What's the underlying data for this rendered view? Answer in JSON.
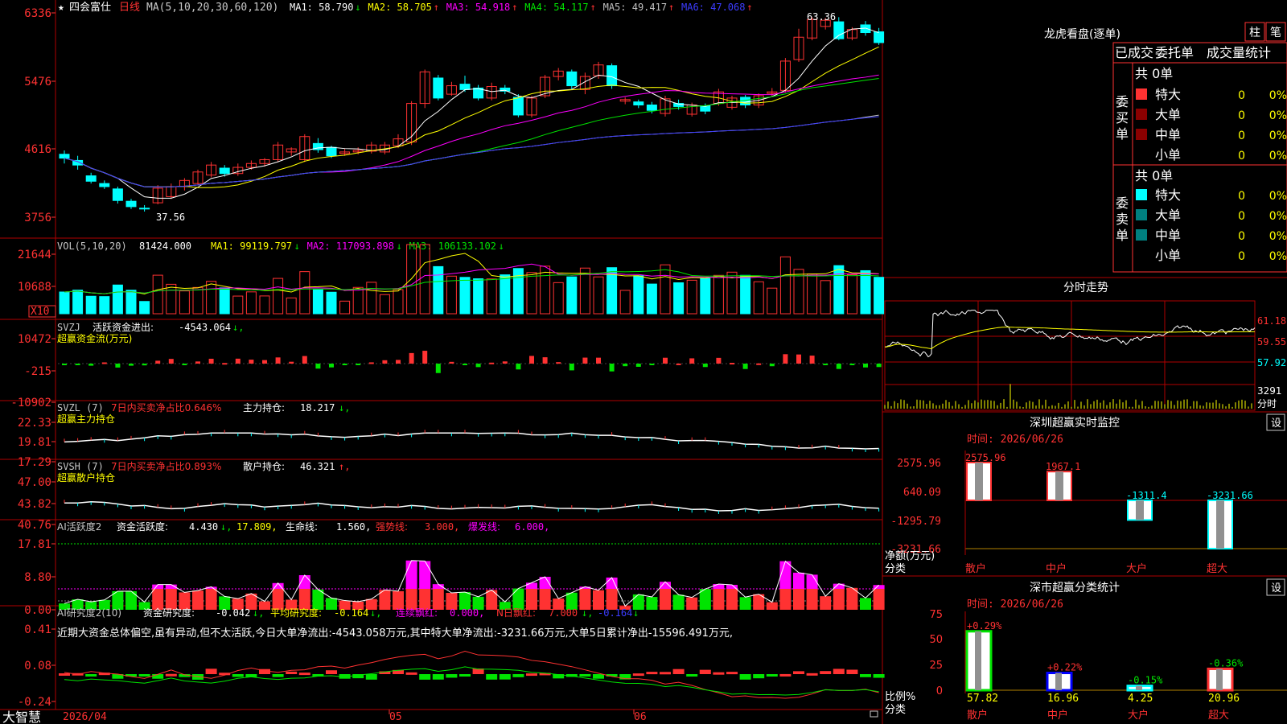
{
  "colors": {
    "red": "#ff3232",
    "cyan": "#00ffff",
    "white": "#ffffff",
    "yellow": "#ffff00",
    "magenta": "#ff00ff",
    "green": "#00e400",
    "blue": "#0000ff",
    "gray": "#c0c0c0",
    "grid": "#b00000"
  },
  "main": {
    "star": "★",
    "stock_name": "四会富仕",
    "period": "日线",
    "ma_label": "MA(5,10,20,30,60,120)",
    "ma_items": [
      {
        "name": "MA1:",
        "value": "58.790",
        "arrow": "↓",
        "color": "#ffffff"
      },
      {
        "name": "MA2:",
        "value": "58.705",
        "arrow": "↑",
        "color": "#ffff00"
      },
      {
        "name": "MA3:",
        "value": "54.918",
        "arrow": "↑",
        "color": "#ff00ff"
      },
      {
        "name": "MA4:",
        "value": "54.117",
        "arrow": "↑",
        "color": "#00e400"
      },
      {
        "name": "MA5:",
        "value": "49.417",
        "arrow": "↑",
        "color": "#c0c0c0"
      },
      {
        "name": "MA6:",
        "value": "47.068",
        "arrow": "↑",
        "color": "#3c3cff"
      }
    ],
    "y_ticks": [
      "6336",
      "5476",
      "4616",
      "3756"
    ],
    "high_label": "63.36",
    "low_label": "37.56"
  },
  "vol": {
    "label": "VOL(5,10,20)",
    "value": "81424.000",
    "items": [
      {
        "name": "MA1:",
        "value": "99119.797",
        "arrow": "↓",
        "color": "#ffff00"
      },
      {
        "name": "MA2:",
        "value": "117093.898",
        "arrow": "↓",
        "color": "#ff00ff"
      },
      {
        "name": "MA3:",
        "value": "106133.102",
        "arrow": "↓",
        "color": "#00e400"
      }
    ],
    "y_ticks": [
      "21644",
      "10688"
    ],
    "unit": "X10"
  },
  "svzj": {
    "label": "SVZJ",
    "title": "活跃资金进出:",
    "value": "-4543.064",
    "arrow": "↓,",
    "subtitle": "超赢资金流(万元)",
    "y_ticks": [
      "10472",
      "-215",
      "-10902"
    ]
  },
  "svzl": {
    "label": "SVZL (7)",
    "text1": "7日内买卖净占比0.646%",
    "text2": "主力持仓:",
    "value": "18.217",
    "arrow": "↓,",
    "subtitle": "超赢主力持仓",
    "y_ticks": [
      "22.33",
      "19.81",
      "17.29"
    ]
  },
  "svsh": {
    "label": "SVSH (7)",
    "text1": "7日内买卖净占比0.893%",
    "text2": "散户持仓:",
    "value": "46.321",
    "arrow": "↑,",
    "subtitle": "超赢散户持仓",
    "y_ticks": [
      "47.00",
      "43.82",
      "40.76"
    ]
  },
  "ai1": {
    "label": "AI活跃度2",
    "t1": "资金活跃度:",
    "v1": "4.430",
    "a1": "↓,",
    "v2": "17.809,",
    "t3": "生命线:",
    "v3": "1.560,",
    "t4": "强势线:",
    "v4": "3.000,",
    "t5": "爆发线:",
    "v5": "6.000,",
    "y_ticks": [
      "17.81",
      "8.80",
      "0.00"
    ]
  },
  "ai2": {
    "label": "AI研究度2(10)",
    "t1": "资金研究度:",
    "v1": "-0.042",
    "a1": "↓,",
    "t2": "平均研究度:",
    "v2": "-0.164",
    "a2": "↓,",
    "t3": "连续飘红:",
    "v3": "0.000,",
    "t4": "N日飘红:",
    "v4": "7.000",
    "a4": "↓,",
    "v5": "-0.164",
    "a5": "↓",
    "comment": "近期大资金总体偏空,虽有异动,但不太活跃,今日大单净流出:-4543.058万元,其中特大单净流出:-3231.66万元,大单5日累计净出-15596.491万元,",
    "y_ticks": [
      "0.41",
      "0.08",
      "-0.24"
    ]
  },
  "footer": {
    "brand": "大智慧",
    "date": "2026/04",
    "m1": "05",
    "m2": "06"
  },
  "right": {
    "title": "龙虎看盘(逐单)",
    "btn1": "柱",
    "btn2": "笔",
    "tabs": [
      "已成交",
      "委托单",
      "成交量统计"
    ],
    "buy_label": "委买单",
    "sell_label": "委卖单",
    "buy_total": "共 0单",
    "sell_total": "共 0单",
    "rows": [
      {
        "name": "特大",
        "count": "0",
        "pct": "0%"
      },
      {
        "name": "大单",
        "count": "0",
        "pct": "0%"
      },
      {
        "name": "中单",
        "count": "0",
        "pct": "0%"
      },
      {
        "name": "小单",
        "count": "0",
        "pct": "0%"
      }
    ],
    "trend_title": "分时走势",
    "trend_ticks": [
      "61.18",
      "59.55",
      "57.92"
    ],
    "trend_vol": "3291",
    "trend_unit": "分时",
    "monitor_title": "深圳超赢实时监控",
    "monitor_set": "设",
    "monitor_time": "时间: 2026/06/26",
    "monitor_ticks": [
      "2575.96",
      "640.09",
      "-1295.79",
      "-3231.66"
    ],
    "monitor_axis_label": "净额(万元)",
    "monitor_cat_label": "分类",
    "monitor_bars": [
      {
        "cat": "散户",
        "value": 2575.96,
        "label": "2575.96"
      },
      {
        "cat": "中户",
        "value": 1967.1,
        "label": "1967.1"
      },
      {
        "cat": "大户",
        "value": -1311.4,
        "label": "-1311.4"
      },
      {
        "cat": "超大",
        "value": -3231.66,
        "label": "-3231.66"
      }
    ],
    "stat_title": "深市超赢分类统计",
    "stat_set": "设",
    "stat_time": "时间: 2026/06/26",
    "stat_ticks": [
      "75",
      "50",
      "25",
      "0"
    ],
    "stat_axis": "比例%",
    "stat_cat": "分类",
    "stat_bars": [
      {
        "cat": "散户",
        "value": 57.82,
        "label": "57.82",
        "change": "+0.29%",
        "color": "#00e400"
      },
      {
        "cat": "中户",
        "value": 16.96,
        "label": "16.96",
        "change": "+0.22%",
        "color": "#0000ff"
      },
      {
        "cat": "大户",
        "value": 4.25,
        "label": "4.25",
        "change": "-0.15%",
        "color": "#00ffff"
      },
      {
        "cat": "超大",
        "value": 20.96,
        "label": "20.96",
        "change": "-0.36%",
        "color": "#ff3232"
      }
    ]
  },
  "chart_data": {
    "type": "candlestick",
    "x_labels": [
      "2026/04",
      "05",
      "06"
    ],
    "ylim": [
      37.56,
      63.36
    ],
    "candles": [
      [
        45,
        44.5,
        45.5,
        43.8
      ],
      [
        44.2,
        43.6,
        44.8,
        43
      ],
      [
        42.2,
        41.5,
        42.6,
        41.2
      ],
      [
        41.2,
        40.8,
        41.6,
        40.5
      ],
      [
        40.5,
        39,
        40.8,
        38.6
      ],
      [
        38.9,
        38.2,
        39.2,
        37.9
      ],
      [
        38,
        37.9,
        38.4,
        37.56
      ],
      [
        38.7,
        40.6,
        41,
        38.5
      ],
      [
        39.5,
        40.8,
        41.2,
        39.2
      ],
      [
        40.8,
        41.6,
        41.9,
        40.3
      ],
      [
        41.2,
        42.7,
        43,
        41
      ],
      [
        42.3,
        43.6,
        44,
        42
      ],
      [
        43.2,
        42.5,
        43.6,
        42.1
      ],
      [
        42.5,
        43.3,
        43.8,
        42.2
      ],
      [
        43.3,
        43.8,
        44.2,
        43
      ],
      [
        43.8,
        44.3,
        44.5,
        43.4
      ],
      [
        44.3,
        46.2,
        46.6,
        44
      ],
      [
        45.3,
        45.7,
        45.9,
        44.8
      ],
      [
        44.3,
        47.3,
        47.6,
        44
      ],
      [
        46.4,
        45.6,
        47.1,
        45.2
      ],
      [
        45.9,
        44.8,
        46.1,
        44.5
      ],
      [
        45.1,
        45.3,
        45.7,
        44.8
      ],
      [
        45.3,
        45.5,
        45.9,
        45
      ],
      [
        45.4,
        46.2,
        46.6,
        45.1
      ],
      [
        45.3,
        46.2,
        46.6,
        45
      ],
      [
        46.1,
        47,
        47.6,
        45.8
      ],
      [
        46.6,
        51.6,
        51.9,
        46.2
      ],
      [
        51.6,
        55.7,
        56,
        51
      ],
      [
        54.9,
        52.3,
        55.3,
        52
      ],
      [
        52.8,
        53.9,
        54.4,
        52.6
      ],
      [
        54.1,
        53.4,
        55.2,
        53.1
      ],
      [
        53.6,
        52.3,
        54,
        52
      ],
      [
        52.3,
        53.8,
        54.3,
        52
      ],
      [
        53.6,
        53.2,
        54,
        52.8
      ],
      [
        52.4,
        50.1,
        52.8,
        49.8
      ],
      [
        50.1,
        52.3,
        52.6,
        49.8
      ],
      [
        52.6,
        55,
        55.3,
        52.3
      ],
      [
        55.1,
        55.8,
        56.2,
        54.6
      ],
      [
        55.7,
        53.9,
        56,
        53.4
      ],
      [
        53.4,
        55.1,
        55.6,
        52.8
      ],
      [
        55.2,
        56.6,
        57,
        54.8
      ],
      [
        56.5,
        53.9,
        56.8,
        53.5
      ],
      [
        51.9,
        52.1,
        52.4,
        51.5
      ],
      [
        51.8,
        51.4,
        52.1,
        51
      ],
      [
        51.4,
        50.7,
        51.8,
        50.3
      ],
      [
        50.3,
        52.2,
        52.6,
        49.9
      ],
      [
        51.6,
        51.2,
        52.1,
        50.8
      ],
      [
        50.2,
        51.4,
        51.7,
        49.9
      ],
      [
        51.3,
        50.6,
        51.6,
        50.2
      ],
      [
        51.6,
        53.1,
        53.5,
        51.3
      ],
      [
        51.1,
        52.3,
        52.6,
        50.8
      ],
      [
        52.4,
        51.4,
        52.7,
        51
      ],
      [
        51.4,
        52.6,
        52.9,
        51
      ],
      [
        52.9,
        53.1,
        53.6,
        52.6
      ],
      [
        53.3,
        57.1,
        57.5,
        53
      ],
      [
        57.3,
        60.2,
        61.3,
        57
      ],
      [
        60.1,
        62.5,
        62.8,
        59.8
      ],
      [
        61.6,
        62.4,
        62.7,
        61.2
      ],
      [
        62.2,
        60,
        62.8,
        59.8
      ],
      [
        60.1,
        61.2,
        61.5,
        59.8
      ],
      [
        61.8,
        60.8,
        62.3,
        60.4
      ],
      [
        60.9,
        59.5,
        61.4,
        59.2
      ]
    ]
  }
}
